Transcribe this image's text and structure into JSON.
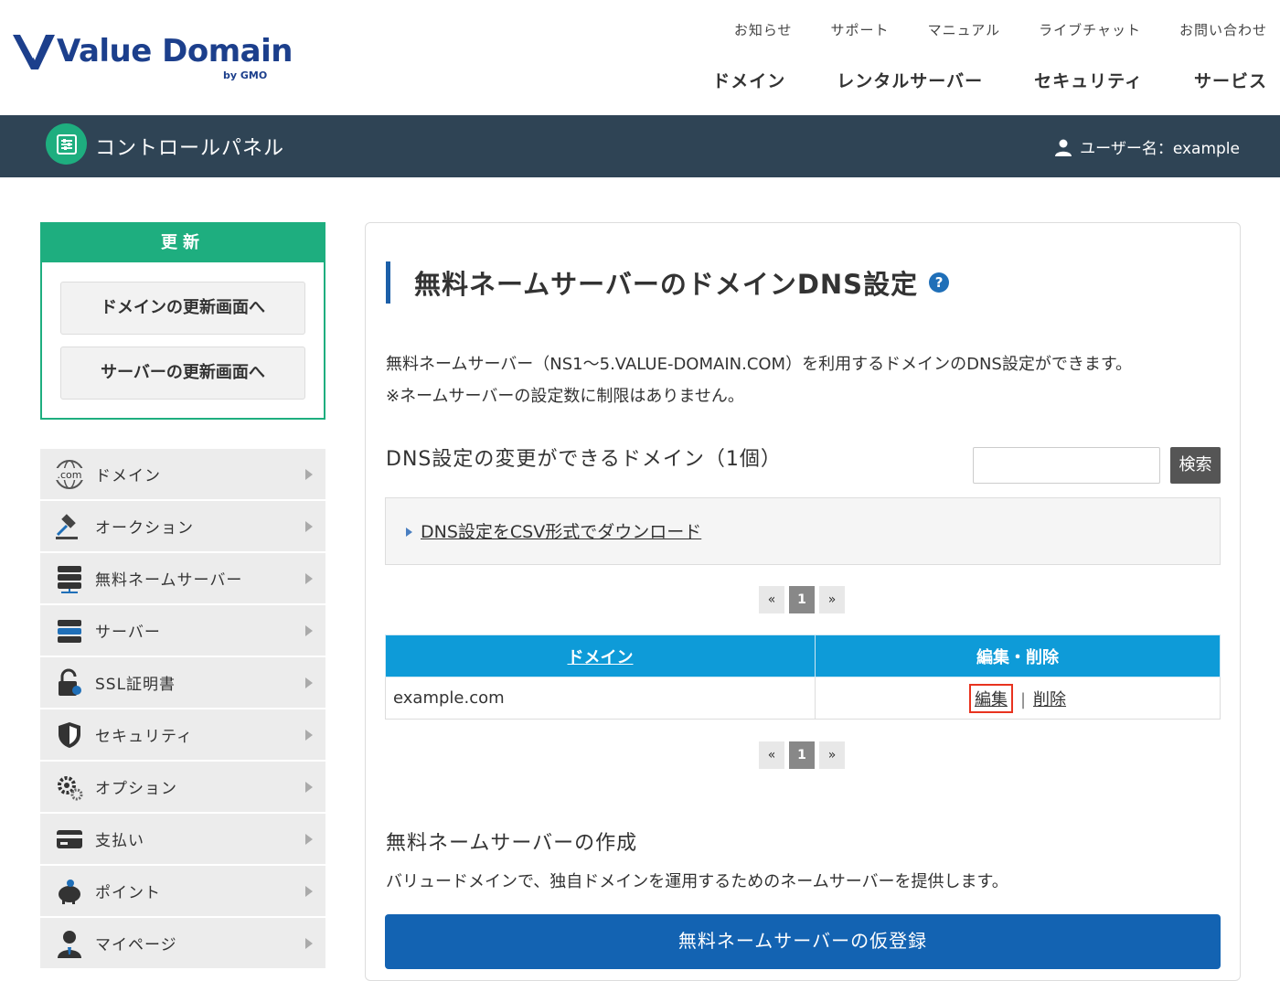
{
  "brand": {
    "name": "Value Domain",
    "sub": "by GMO"
  },
  "util_nav": [
    "お知らせ",
    "サポート",
    "マニュアル",
    "ライブチャット",
    "お問い合わせ"
  ],
  "main_nav": [
    "ドメイン",
    "レンタルサーバー",
    "セキュリティ",
    "サービス"
  ],
  "cp_bar": {
    "title": "コントロールパネル",
    "user_label": "ユーザー名：example"
  },
  "renew": {
    "heading": "更新",
    "domain_button": "ドメインの更新画面へ",
    "server_button": "サーバーの更新画面へ"
  },
  "sidebar": {
    "items": [
      {
        "label": "ドメイン",
        "icon": "domain-com-icon"
      },
      {
        "label": "オークション",
        "icon": "gavel-icon"
      },
      {
        "label": "無料ネームサーバー",
        "icon": "nameserver-icon"
      },
      {
        "label": "サーバー",
        "icon": "server-icon"
      },
      {
        "label": "SSL証明書",
        "icon": "ssl-lock-icon"
      },
      {
        "label": "セキュリティ",
        "icon": "shield-icon"
      },
      {
        "label": "オプション",
        "icon": "gear-icon"
      },
      {
        "label": "支払い",
        "icon": "card-icon"
      },
      {
        "label": "ポイント",
        "icon": "piggy-bank-icon"
      },
      {
        "label": "マイページ",
        "icon": "user-icon"
      }
    ]
  },
  "main": {
    "title": "無料ネームサーバーのドメインDNS設定",
    "desc1": "無料ネームサーバー（NS1〜5.VALUE-DOMAIN.COM）を利用するドメインのDNS設定ができます。",
    "desc2": "※ネームサーバーの設定数に制限はありません。",
    "list_title": "DNS設定の変更ができるドメイン（1個）",
    "search_value": "",
    "search_button": "検索",
    "csv_link": "DNS設定をCSV形式でダウンロード",
    "pager": {
      "prev": "«",
      "current": "1",
      "next": "»"
    },
    "table": {
      "headers": [
        "ドメイン",
        "編集・削除"
      ],
      "rows": [
        {
          "domain": "example.com",
          "edit": "編集",
          "sep": "|",
          "delete": "削除"
        }
      ]
    },
    "create_title": "無料ネームサーバーの作成",
    "create_desc": "バリュードメインで、独自ドメインを運用するためのネームサーバーを提供します。",
    "register_button": "無料ネームサーバーの仮登録"
  }
}
